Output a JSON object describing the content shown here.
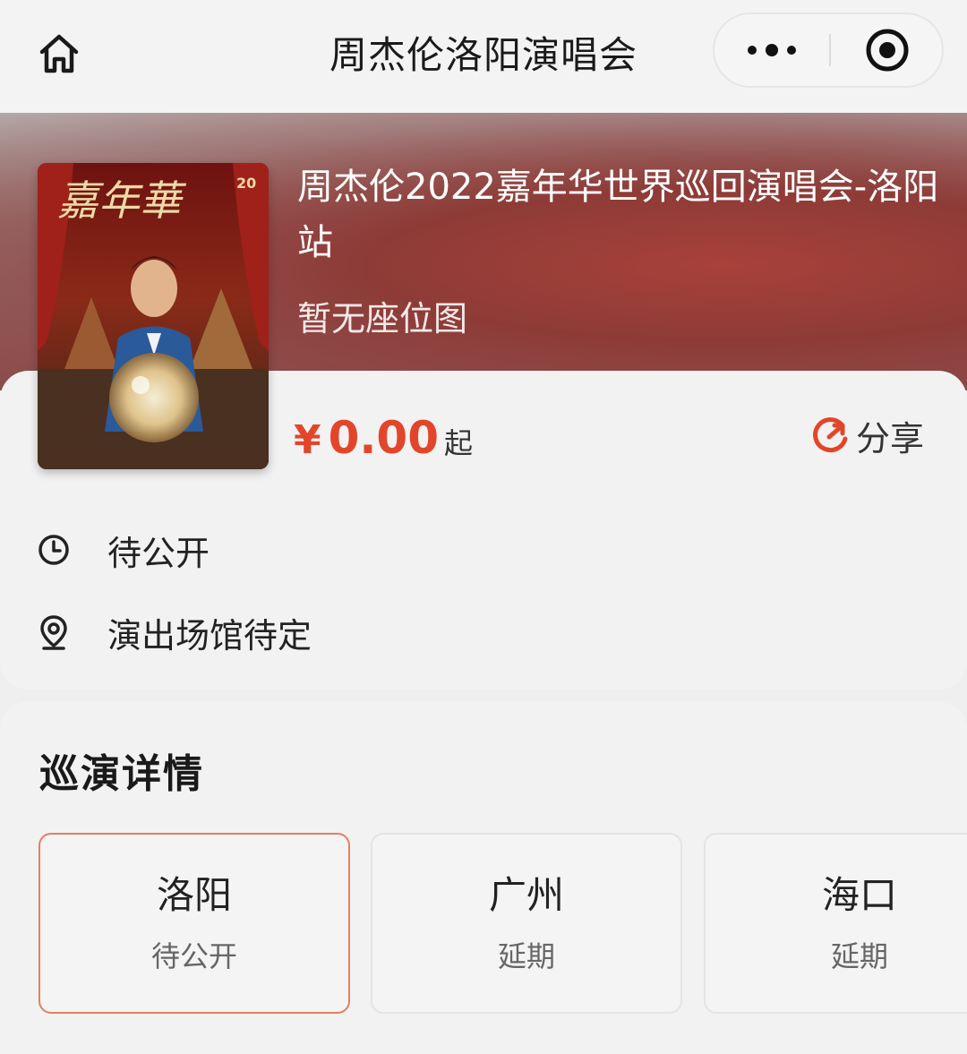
{
  "navbar": {
    "title": "周杰伦洛阳演唱会",
    "home_icon": "home-icon",
    "more_icon": "more-dots-icon",
    "close_icon": "target-close-icon"
  },
  "event": {
    "title": "周杰伦2022嘉年华世界巡回演唱会-洛阳站",
    "seat_map_note": "暂无座位图",
    "poster_text": "嘉年華",
    "poster_badge": "20"
  },
  "price": {
    "symbol": "¥",
    "value": "0.00",
    "suffix": "起",
    "color": "#e2462a"
  },
  "share": {
    "label": "分享",
    "icon": "share-icon"
  },
  "info": {
    "time": "待公开",
    "time_icon": "clock-icon",
    "venue": "演出场馆待定",
    "venue_icon": "location-pin-icon"
  },
  "tour": {
    "heading": "巡演详情",
    "cities": [
      {
        "name": "洛阳",
        "status": "待公开",
        "selected": true
      },
      {
        "name": "广州",
        "status": "延期",
        "selected": false
      },
      {
        "name": "海口",
        "status": "延期",
        "selected": false
      }
    ]
  }
}
